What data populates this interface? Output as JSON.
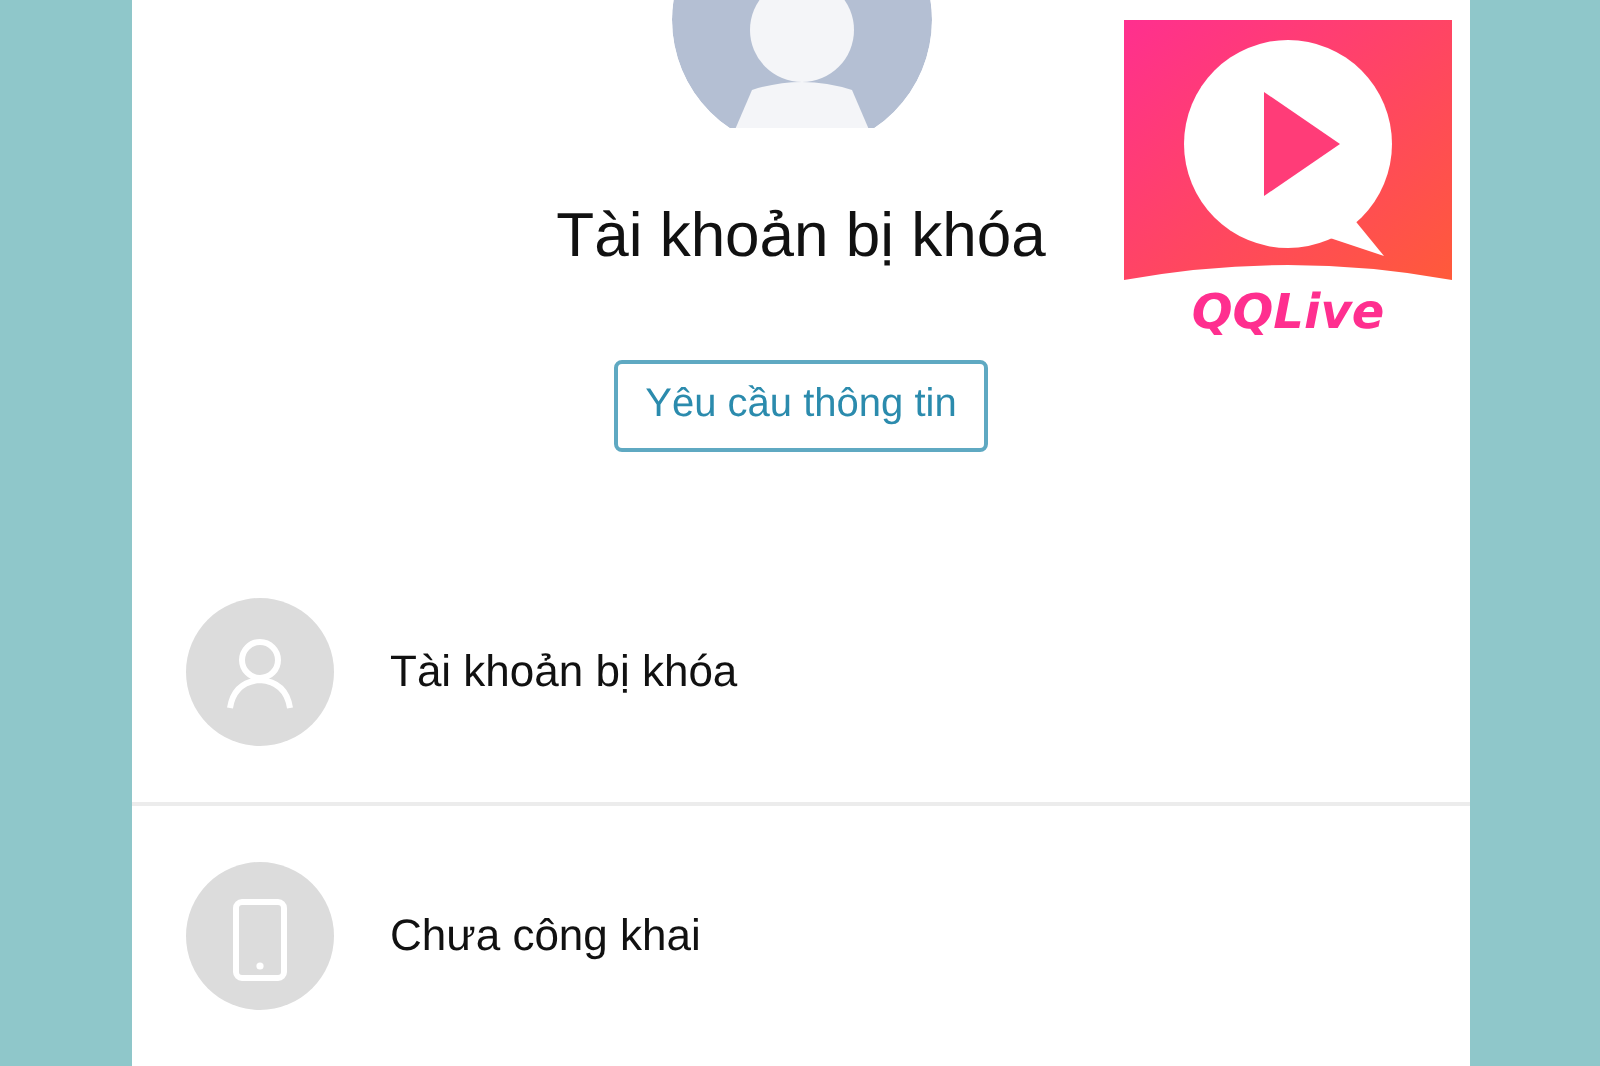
{
  "profile": {
    "title": "Tài khoản bị khóa",
    "button": "Yêu cầu thông tin"
  },
  "items": [
    {
      "kind": "person",
      "label": "Tài khoản bị khóa"
    },
    {
      "kind": "phone",
      "label": "Chưa công khai"
    }
  ],
  "logo": {
    "text": "QQLive"
  }
}
